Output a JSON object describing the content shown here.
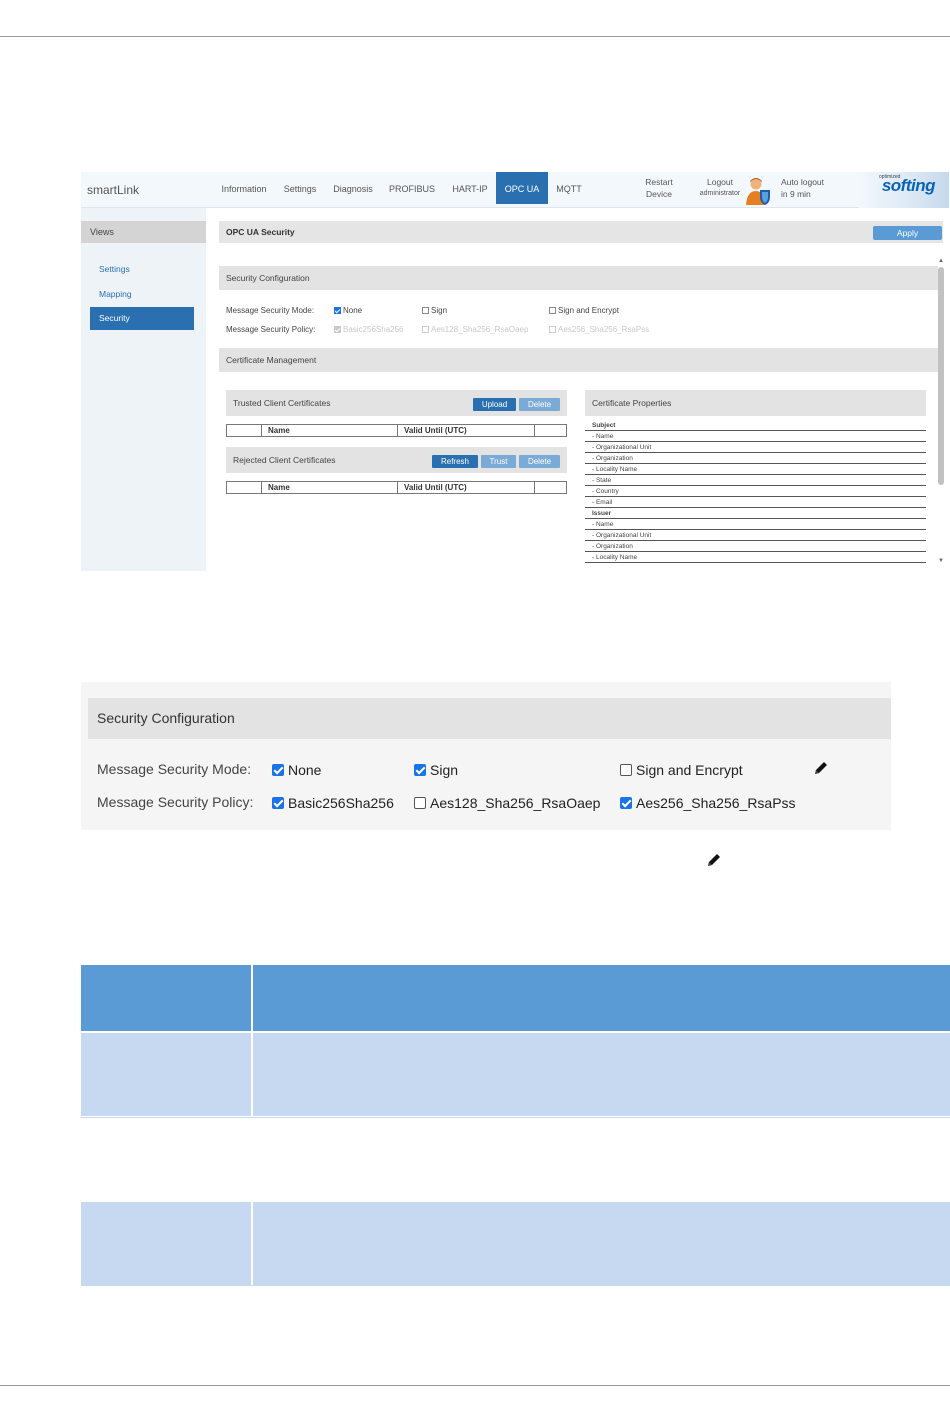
{
  "screenshot1": {
    "brand": "smartLink",
    "nav": [
      "Information",
      "Settings",
      "Diagnosis",
      "PROFIBUS",
      "HART-IP",
      "OPC UA",
      "MQTT"
    ],
    "nav_active": "OPC UA",
    "restart": {
      "line1": "Restart",
      "line2": "Device"
    },
    "logout": {
      "line1": "Logout",
      "line2": "administrator"
    },
    "auto_logout": {
      "line1": "Auto logout",
      "line2": "in 9 min"
    },
    "logo": {
      "top": "optimized",
      "name": "softing"
    },
    "sidebar": {
      "heading": "Views",
      "items": [
        "Settings",
        "Mapping",
        "Security"
      ],
      "active": "Security"
    },
    "content": {
      "title": "OPC UA Security",
      "apply_label": "Apply",
      "security_config_title": "Security Configuration",
      "mode_label": "Message Security Mode:",
      "mode_options": [
        {
          "label": "None",
          "checked": true
        },
        {
          "label": "Sign",
          "checked": false
        },
        {
          "label": "Sign and Encrypt",
          "checked": false
        }
      ],
      "policy_label": "Message Security Policy:",
      "policy_options": [
        {
          "label": "Basic256Sha256",
          "checked": true
        },
        {
          "label": "Aes128_Sha256_RsaOaep",
          "checked": false
        },
        {
          "label": "Aes256_Sha256_RsaPss",
          "checked": false
        }
      ],
      "cert_mgmt_title": "Certificate Management",
      "trusted": {
        "title": "Trusted Client Certificates",
        "buttons": [
          "Upload",
          "Delete"
        ],
        "columns": [
          "Name",
          "Valid Until (UTC)"
        ]
      },
      "rejected": {
        "title": "Rejected Client Certificates",
        "buttons": [
          "Refresh",
          "Trust",
          "Delete"
        ],
        "columns": [
          "Name",
          "Valid Until (UTC)"
        ]
      },
      "properties": {
        "title": "Certificate Properties",
        "lines": [
          "Subject",
          "- Name",
          "- Organizational Unit",
          "- Organization",
          "- Locality Name",
          "- State",
          "- Country",
          "- Email",
          "Issuer",
          "- Name",
          "- Organizational Unit",
          "- Organization",
          "- Locality Name"
        ]
      }
    }
  },
  "screenshot2": {
    "title": "Security Configuration",
    "mode_label": "Message Security Mode:",
    "mode_options": [
      {
        "label": "None",
        "checked": true
      },
      {
        "label": "Sign",
        "checked": true
      },
      {
        "label": "Sign and Encrypt",
        "checked": false
      }
    ],
    "policy_label": "Message Security Policy:",
    "policy_options": [
      {
        "label": "Basic256Sha256",
        "checked": true
      },
      {
        "label": "Aes128_Sha256_RsaOaep",
        "checked": false
      },
      {
        "label": "Aes256_Sha256_RsaPss",
        "checked": true
      }
    ]
  },
  "icons": {
    "pencil": "pencil-icon",
    "user": "user-shield-icon"
  },
  "colors": {
    "accent": "#2a6fb0",
    "apply": "#5b9bd5",
    "table_header": "#5b9bd5",
    "table_band": "#c6d9f1",
    "checkbox": "#1a73e8"
  }
}
